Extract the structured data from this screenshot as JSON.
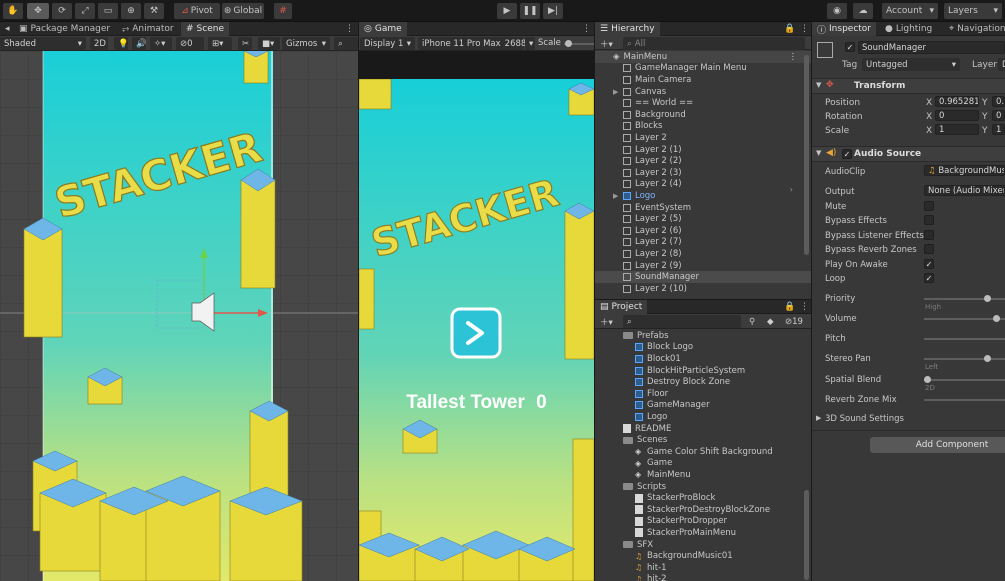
{
  "toolbar": {
    "pivot": "Pivot",
    "global": "Global",
    "account": "Account",
    "layers": "Layers"
  },
  "scene_panel": {
    "tabs": [
      "Package Manager",
      "Animator",
      "Scene"
    ],
    "shading": "Shaded",
    "mode_2d": "2D",
    "hidden_count": "0",
    "gizmos": "Gizmos",
    "title_text": "STACKER"
  },
  "game_panel": {
    "tab": "Game",
    "display": "Display 1",
    "device": "iPhone 11 Pro Max",
    "resolution": "2688:",
    "scale_label": "Scale",
    "title_text": "STACKER",
    "tallest_tower_label": "Tallest Tower",
    "tallest_tower_value": "0"
  },
  "hierarchy": {
    "tab": "Hierarchy",
    "search_placeholder": "All",
    "scene": "MainMenu",
    "items": [
      {
        "name": "GameManager Main Menu",
        "icon": "cube",
        "arrow": ""
      },
      {
        "name": "Main Camera",
        "icon": "cube",
        "arrow": ""
      },
      {
        "name": "Canvas",
        "icon": "cube",
        "arrow": "▶"
      },
      {
        "name": "== World ==",
        "icon": "cube",
        "arrow": ""
      },
      {
        "name": "Background",
        "icon": "cube",
        "arrow": ""
      },
      {
        "name": "Blocks",
        "icon": "cube",
        "arrow": ""
      },
      {
        "name": "Layer 2",
        "icon": "cube",
        "arrow": ""
      },
      {
        "name": "Layer 2 (1)",
        "icon": "cube",
        "arrow": ""
      },
      {
        "name": "Layer 2 (2)",
        "icon": "cube",
        "arrow": ""
      },
      {
        "name": "Layer 2 (3)",
        "icon": "cube",
        "arrow": ""
      },
      {
        "name": "Layer 2 (4)",
        "icon": "cube",
        "arrow": ""
      },
      {
        "name": "Logo",
        "icon": "cube-blue",
        "arrow": "▶"
      },
      {
        "name": "EventSystem",
        "icon": "cube",
        "arrow": ""
      },
      {
        "name": "Layer 2 (5)",
        "icon": "cube",
        "arrow": ""
      },
      {
        "name": "Layer 2 (6)",
        "icon": "cube",
        "arrow": ""
      },
      {
        "name": "Layer 2 (7)",
        "icon": "cube",
        "arrow": ""
      },
      {
        "name": "Layer 2 (8)",
        "icon": "cube",
        "arrow": ""
      },
      {
        "name": "Layer 2 (9)",
        "icon": "cube",
        "arrow": ""
      },
      {
        "name": "SoundManager",
        "icon": "cube",
        "arrow": "",
        "selected": true
      },
      {
        "name": "Layer 2 (10)",
        "icon": "cube",
        "arrow": ""
      }
    ]
  },
  "project": {
    "tab": "Project",
    "hidden_count": "19",
    "items": [
      {
        "name": "Prefabs",
        "icon": "folder",
        "indent": 0
      },
      {
        "name": "Block Logo",
        "icon": "cube-blue",
        "indent": 1
      },
      {
        "name": "Block01",
        "icon": "cube-blue",
        "indent": 1
      },
      {
        "name": "BlockHitParticleSystem",
        "icon": "cube-blue",
        "indent": 1
      },
      {
        "name": "Destroy Block Zone",
        "icon": "cube-blue",
        "indent": 1
      },
      {
        "name": "Floor",
        "icon": "cube-blue",
        "indent": 1
      },
      {
        "name": "GameManager",
        "icon": "cube-blue",
        "indent": 1
      },
      {
        "name": "Logo",
        "icon": "cube-blue",
        "indent": 1
      },
      {
        "name": "README",
        "icon": "script",
        "indent": 0
      },
      {
        "name": "Scenes",
        "icon": "folder",
        "indent": 0
      },
      {
        "name": "Game Color Shift Background",
        "icon": "scene",
        "indent": 1
      },
      {
        "name": "Game",
        "icon": "scene",
        "indent": 1
      },
      {
        "name": "MainMenu",
        "icon": "scene",
        "indent": 1
      },
      {
        "name": "Scripts",
        "icon": "folder",
        "indent": 0
      },
      {
        "name": "StackerProBlock",
        "icon": "script",
        "indent": 1
      },
      {
        "name": "StackerProDestroyBlockZone",
        "icon": "script",
        "indent": 1
      },
      {
        "name": "StackerProDropper",
        "icon": "script",
        "indent": 1
      },
      {
        "name": "StackerProMainMenu",
        "icon": "script",
        "indent": 1
      },
      {
        "name": "SFX",
        "icon": "folder",
        "indent": 0
      },
      {
        "name": "BackgroundMusic01",
        "icon": "audio",
        "indent": 1
      },
      {
        "name": "hit-1",
        "icon": "audio",
        "indent": 1
      },
      {
        "name": "hit-2",
        "icon": "audio",
        "indent": 1
      }
    ]
  },
  "inspector": {
    "tabs": [
      "Inspector",
      "Lighting",
      "Navigation"
    ],
    "object_name": "SoundManager",
    "tag_label": "Tag",
    "tag_value": "Untagged",
    "layer_label": "Layer",
    "layer_value": "D",
    "transform": {
      "title": "Transform",
      "position_label": "Position",
      "position_x": "0.965281",
      "position_y": "0.",
      "rotation_label": "Rotation",
      "rotation_x": "0",
      "rotation_y": "0",
      "scale_label": "Scale",
      "scale_x": "1",
      "scale_y": "1"
    },
    "audio_source": {
      "title": "Audio Source",
      "audioclip_label": "AudioClip",
      "audioclip_value": "BackgroundMusi",
      "output_label": "Output",
      "output_value": "None (Audio Mixer G",
      "mute_label": "Mute",
      "bypass_effects_label": "Bypass Effects",
      "bypass_listener_label": "Bypass Listener Effects",
      "bypass_reverb_label": "Bypass Reverb Zones",
      "play_on_awake_label": "Play On Awake",
      "loop_label": "Loop",
      "priority_label": "Priority",
      "priority_hint": "High",
      "volume_label": "Volume",
      "pitch_label": "Pitch",
      "stereo_pan_label": "Stereo Pan",
      "stereo_pan_hint": "Left",
      "spatial_blend_label": "Spatial Blend",
      "spatial_blend_hint": "2D",
      "reverb_zone_mix_label": "Reverb Zone Mix",
      "settings_3d_label": "3D Sound Settings"
    },
    "add_component": "Add Component"
  }
}
